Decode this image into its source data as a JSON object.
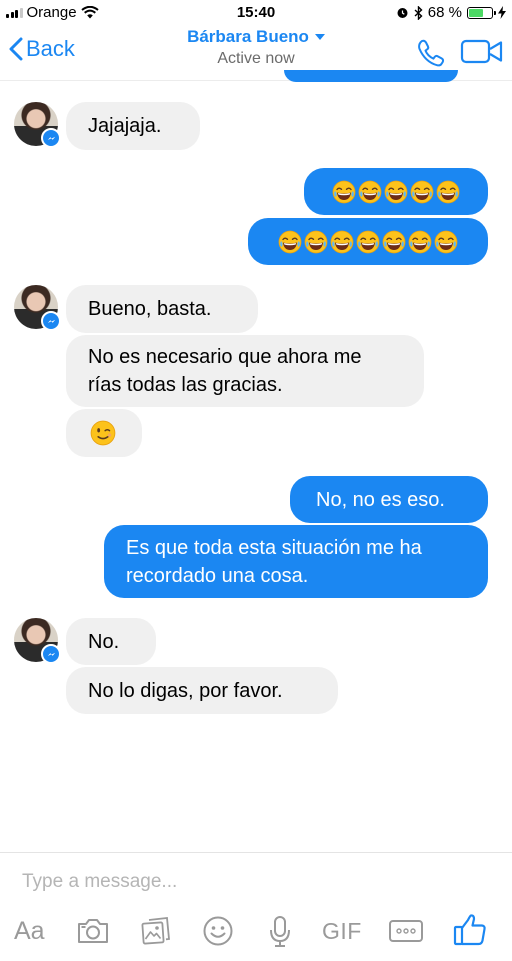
{
  "status_bar": {
    "carrier": "Orange",
    "time": "15:40",
    "battery_percent": "68 %",
    "battery_level": 0.68
  },
  "header": {
    "back_label": "Back",
    "contact_name": "Bárbara Bueno",
    "presence": "Active now"
  },
  "messages": {
    "m1": "Jajajaja.",
    "m2_emoji_count": 5,
    "m3_emoji_count": 7,
    "m4": "Bueno, basta.",
    "m5_line1": "No es necesario que ahora me",
    "m5_line2": "rías todas las gracias.",
    "m6_emoji": "winking-face",
    "m7": "No, no es eso.",
    "m8_line1": "Es que toda esta situación me ha",
    "m8_line2": "recordado una cosa.",
    "m9": "No.",
    "m10": "No lo digas, por favor."
  },
  "composer": {
    "placeholder": "Type a message...",
    "aa_label": "Aa",
    "gif_label": "GIF"
  },
  "colors": {
    "accent": "#1b87f2",
    "incoming_bubble": "#f0f0f0",
    "outgoing_bubble": "#1b87f2",
    "icon_gray": "#9a9a9a"
  },
  "icons": {
    "call": "phone-icon",
    "video": "video-camera-icon",
    "camera": "camera-icon",
    "gallery": "gallery-icon",
    "sticker": "smiley-icon",
    "voice": "microphone-icon",
    "more": "more-icon",
    "like": "thumbs-up-icon"
  }
}
